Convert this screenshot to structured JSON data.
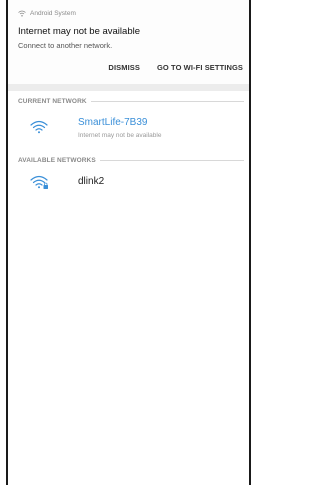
{
  "notification": {
    "app_name": "Android System",
    "title": "Internet may not be available",
    "text": "Connect to another network.",
    "actions": [
      "DISMISS",
      "GO TO WI-FI SETTINGS"
    ]
  },
  "current_network": {
    "header": "CURRENT NETWORK",
    "name": "SmartLife-7B39",
    "status": "Internet may not be available",
    "accent_color": "#3a8fd8"
  },
  "available_networks": {
    "header": "AVAILABLE NETWORKS",
    "items": [
      {
        "name": "dlink2",
        "icon": "wifi-locked-icon"
      }
    ]
  }
}
